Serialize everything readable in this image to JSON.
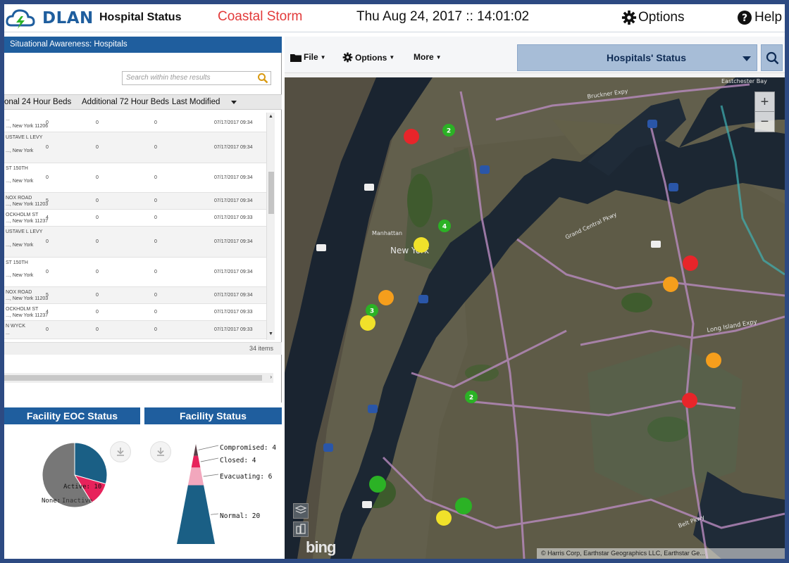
{
  "header": {
    "brand": "DLAN",
    "app_title": "Hospital Status",
    "event_name": "Coastal Storm",
    "datetime": "Thu Aug 24, 2017 :: 14:01:02",
    "options_label": "Options",
    "help_label": "Help"
  },
  "left_panel": {
    "title": "Situational Awareness: Hospitals",
    "search_placeholder": "Search within these results",
    "columns": [
      "onal 24 Hour Beds",
      "Additional 72 Hour Beds",
      "Last Modified"
    ],
    "rows": [
      {
        "name": "...",
        "addr": "..., New York 11206",
        "v24": "0",
        "v72": "0",
        "modified": "07/17/2017 09:34"
      },
      {
        "name": "USTAVE L LEVY",
        "addr": "..., New York",
        "v24": "0",
        "v72": "0",
        "modified": "07/17/2017 09:34"
      },
      {
        "name": "ST 150TH",
        "addr": "..., New York",
        "v24": "0",
        "v72": "0",
        "modified": "07/17/2017 09:34"
      },
      {
        "name": "NOX ROAD",
        "addr": "..., New York 11203",
        "v24": "5",
        "v72": "0",
        "modified": "07/17/2017 09:34"
      },
      {
        "name": "OCKHOLM ST",
        "addr": "..., New York 11237",
        "v24": "4",
        "v72": "0",
        "modified": "07/17/2017 09:33"
      },
      {
        "name": "USTAVE L LEVY",
        "addr": "..., New York",
        "v24": "0",
        "v72": "0",
        "modified": "07/17/2017 09:34"
      },
      {
        "name": "ST 150TH",
        "addr": "..., New York",
        "v24": "0",
        "v72": "0",
        "modified": "07/17/2017 09:34"
      },
      {
        "name": "NOX ROAD",
        "addr": "..., New York 11203",
        "v24": "5",
        "v72": "0",
        "modified": "07/17/2017 09:34"
      },
      {
        "name": "OCKHOLM ST",
        "addr": "..., New York 11237",
        "v24": "4",
        "v72": "0",
        "modified": "07/17/2017 09:33"
      },
      {
        "name": "N WYCK",
        "addr": "...",
        "v24": "0",
        "v72": "0",
        "modified": "07/17/2017 09:33"
      }
    ],
    "item_count": "34 items"
  },
  "eoc_chart": {
    "title": "Facility EOC Status",
    "labels": [
      "Active: 10",
      "None:",
      "Inactive"
    ]
  },
  "status_chart": {
    "title": "Facility Status",
    "labels": [
      "Compromised: 4",
      "Closed: 4",
      "Evacuating: 6",
      "Normal: 20"
    ]
  },
  "chart_data": [
    {
      "type": "pie",
      "title": "Facility EOC Status",
      "categories": [
        "Active",
        "Inactive",
        "None"
      ],
      "values": [
        10,
        4,
        20
      ],
      "colors": [
        "#1a5f85",
        "#e7225b",
        "#777777"
      ]
    },
    {
      "type": "bar",
      "title": "Facility Status",
      "categories": [
        "Compromised",
        "Closed",
        "Evacuating",
        "Normal"
      ],
      "values": [
        4,
        4,
        6,
        20
      ],
      "colors": [
        "#5c4048",
        "#e7225b",
        "#f2a7bd",
        "#1a5f85"
      ]
    }
  ],
  "map": {
    "toolbar": {
      "file": "File",
      "options": "Options",
      "more": "More",
      "layer": "Hospitals' Status"
    },
    "zoom_in": "+",
    "zoom_out": "−",
    "bing": "bing",
    "attribution": "© Harris Corp, Earthstar Geographics LLC, Earthstar Ge...",
    "label_newyork": "New York",
    "label_manhattan": "Manhattan",
    "label_lie": "Long Island Expy",
    "label_eastchester": "Eastchester Bay",
    "label_belt": "Belt Pkwy",
    "label_grand": "Grand Central Pkwy",
    "label_bruckner": "Bruckner Expy",
    "markers": [
      {
        "status": "red",
        "label": ""
      },
      {
        "status": "green",
        "label": "2"
      },
      {
        "status": "green",
        "label": "4"
      },
      {
        "status": "yellow",
        "label": ""
      },
      {
        "status": "orange",
        "label": ""
      },
      {
        "status": "green",
        "label": "3"
      },
      {
        "status": "yellow",
        "label": ""
      },
      {
        "status": "green",
        "label": "2"
      },
      {
        "status": "red",
        "label": ""
      },
      {
        "status": "orange",
        "label": ""
      },
      {
        "status": "orange",
        "label": ""
      },
      {
        "status": "red",
        "label": ""
      },
      {
        "status": "green",
        "label": ""
      },
      {
        "status": "green",
        "label": ""
      },
      {
        "status": "yellow",
        "label": ""
      }
    ],
    "colors": {
      "red": "#e8252a",
      "green": "#2bb225",
      "yellow": "#f0e12a",
      "orange": "#f59e1c"
    }
  }
}
